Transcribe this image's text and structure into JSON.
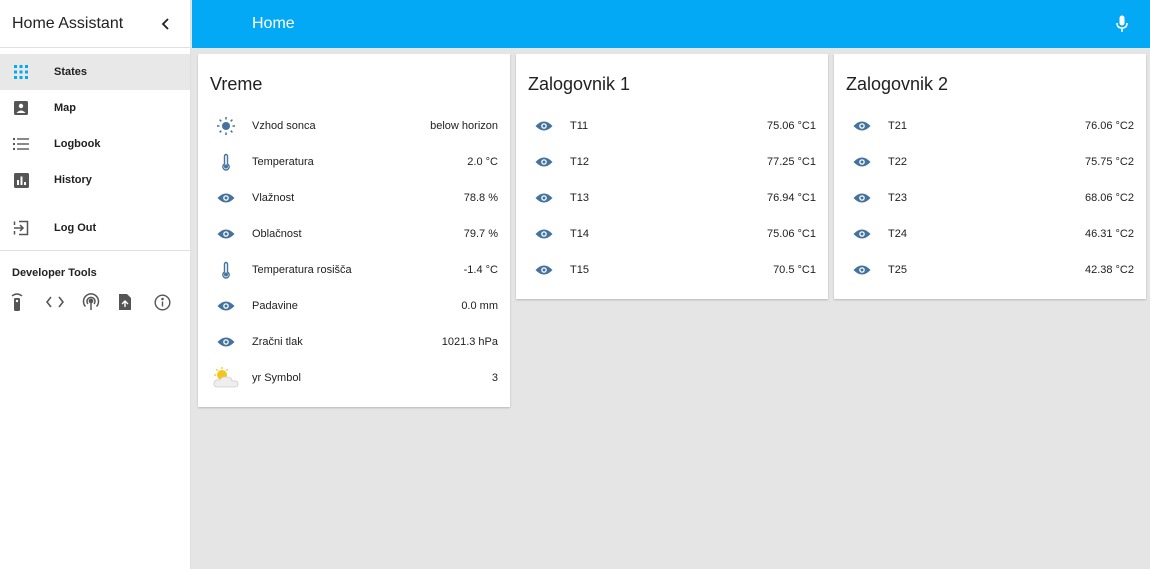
{
  "app": {
    "title": "Home Assistant"
  },
  "topbar": {
    "title": "Home"
  },
  "sidebar": {
    "items": [
      {
        "label": "States",
        "icon": "grid-icon"
      },
      {
        "label": "Map",
        "icon": "map-icon"
      },
      {
        "label": "Logbook",
        "icon": "list-icon"
      },
      {
        "label": "History",
        "icon": "chart-icon"
      },
      {
        "label": "Log Out",
        "icon": "logout-icon"
      }
    ],
    "dev_title": "Developer Tools",
    "dev_tools": [
      "remote-icon",
      "code-icon",
      "broadcast-icon",
      "file-export-icon",
      "info-icon"
    ]
  },
  "colors": {
    "accent": "#03a9f4",
    "icon": "#44739e",
    "sun": "#44739e"
  },
  "cards": [
    {
      "title": "Vreme",
      "rows": [
        {
          "icon": "sun-icon",
          "name": "Vzhod sonca",
          "value": "below horizon"
        },
        {
          "icon": "thermometer-icon",
          "name": "Temperatura",
          "value": "2.0 °C"
        },
        {
          "icon": "eye-icon",
          "name": "Vlažnost",
          "value": "78.8 %"
        },
        {
          "icon": "eye-icon",
          "name": "Oblačnost",
          "value": "79.7 %"
        },
        {
          "icon": "thermometer-icon",
          "name": "Temperatura rosišča",
          "value": "-1.4 °C"
        },
        {
          "icon": "eye-icon",
          "name": "Padavine",
          "value": "0.0 mm"
        },
        {
          "icon": "eye-icon",
          "name": "Zračni tlak",
          "value": "1021.3 hPa"
        },
        {
          "icon": "weather-partly-cloudy-icon",
          "name": "yr Symbol",
          "value": "3"
        }
      ]
    },
    {
      "title": "Zalogovnik 1",
      "rows": [
        {
          "icon": "eye-icon",
          "name": "T11",
          "value": "75.06 °C1"
        },
        {
          "icon": "eye-icon",
          "name": "T12",
          "value": "77.25 °C1"
        },
        {
          "icon": "eye-icon",
          "name": "T13",
          "value": "76.94 °C1"
        },
        {
          "icon": "eye-icon",
          "name": "T14",
          "value": "75.06 °C1"
        },
        {
          "icon": "eye-icon",
          "name": "T15",
          "value": "70.5 °C1"
        }
      ]
    },
    {
      "title": "Zalogovnik 2",
      "rows": [
        {
          "icon": "eye-icon",
          "name": "T21",
          "value": "76.06 °C2"
        },
        {
          "icon": "eye-icon",
          "name": "T22",
          "value": "75.75 °C2"
        },
        {
          "icon": "eye-icon",
          "name": "T23",
          "value": "68.06 °C2"
        },
        {
          "icon": "eye-icon",
          "name": "T24",
          "value": "46.31 °C2"
        },
        {
          "icon": "eye-icon",
          "name": "T25",
          "value": "42.38 °C2"
        }
      ]
    }
  ]
}
